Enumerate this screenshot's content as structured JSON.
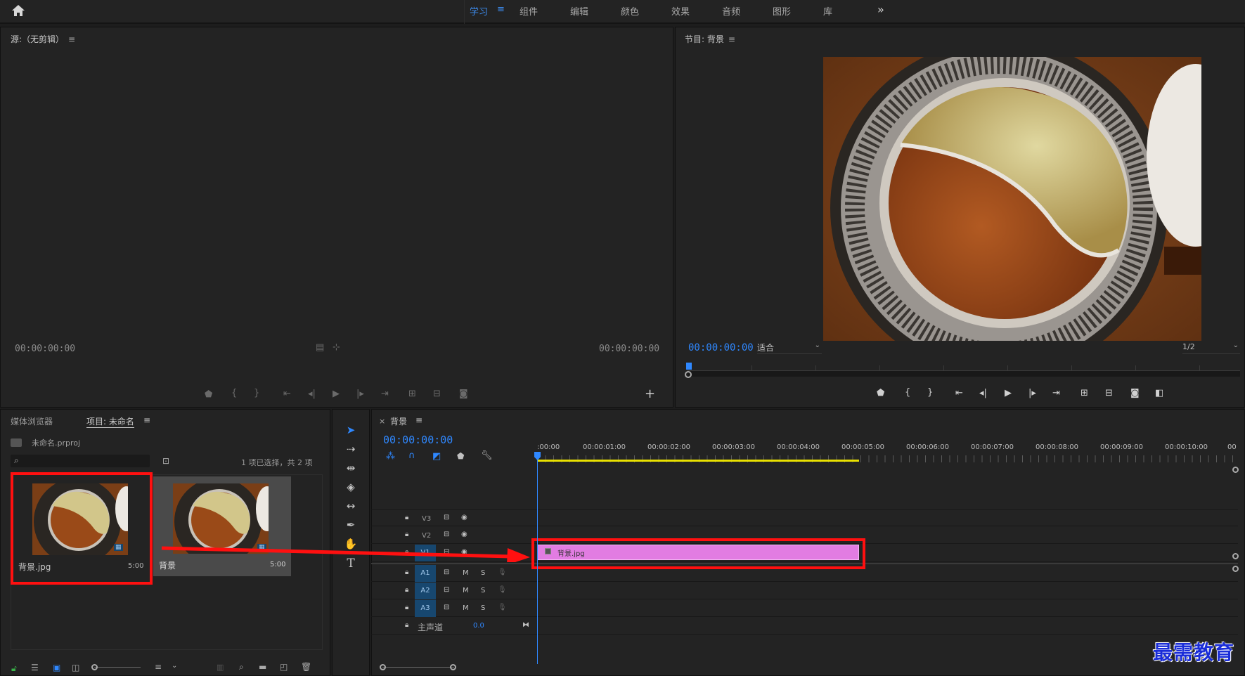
{
  "topbar": {
    "workspaces": [
      "学习",
      "组件",
      "编辑",
      "颜色",
      "效果",
      "音频",
      "图形",
      "库"
    ],
    "active_workspace": "学习"
  },
  "source_monitor": {
    "title": "源:（无剪辑）",
    "timecode_in": "00:00:00:00",
    "timecode_out": "00:00:00:00"
  },
  "program_monitor": {
    "title": "节目: 背景",
    "timecode": "00:00:00:00",
    "fit": "适合",
    "resolution": "1/2"
  },
  "project_panel": {
    "tabs": [
      "媒体浏览器",
      "项目: 未命名"
    ],
    "active_tab": "项目: 未命名",
    "project_file": "未命名.prproj",
    "selection_status": "1 项已选择，共 2 项",
    "items": [
      {
        "name": "背景.jpg",
        "duration": "5:00",
        "highlighted": true
      },
      {
        "name": "背景",
        "duration": "5:00",
        "highlighted": false
      }
    ]
  },
  "timeline": {
    "sequence_name": "背景",
    "timecode": "00:00:00:00",
    "ruler": [
      ":00:00",
      "00:00:01:00",
      "00:00:02:00",
      "00:00:03:00",
      "00:00:04:00",
      "00:00:05:00",
      "00:00:06:00",
      "00:00:07:00",
      "00:00:08:00",
      "00:00:09:00",
      "00:00:10:00",
      "00"
    ],
    "video_tracks": [
      "V3",
      "V2",
      "V1"
    ],
    "audio_tracks": [
      "A1",
      "A2",
      "A3"
    ],
    "audio_track_buttons": {
      "mute": "M",
      "solo": "S"
    },
    "master_track": "主声道",
    "master_value": "0.0",
    "clip_name": "背景.jpg"
  },
  "colors": {
    "accent": "#2f88ff",
    "clip": "#e27ce2",
    "highlight": "#ff1010",
    "in_out_bar": "#e8e000"
  },
  "watermark": "最需教育"
}
